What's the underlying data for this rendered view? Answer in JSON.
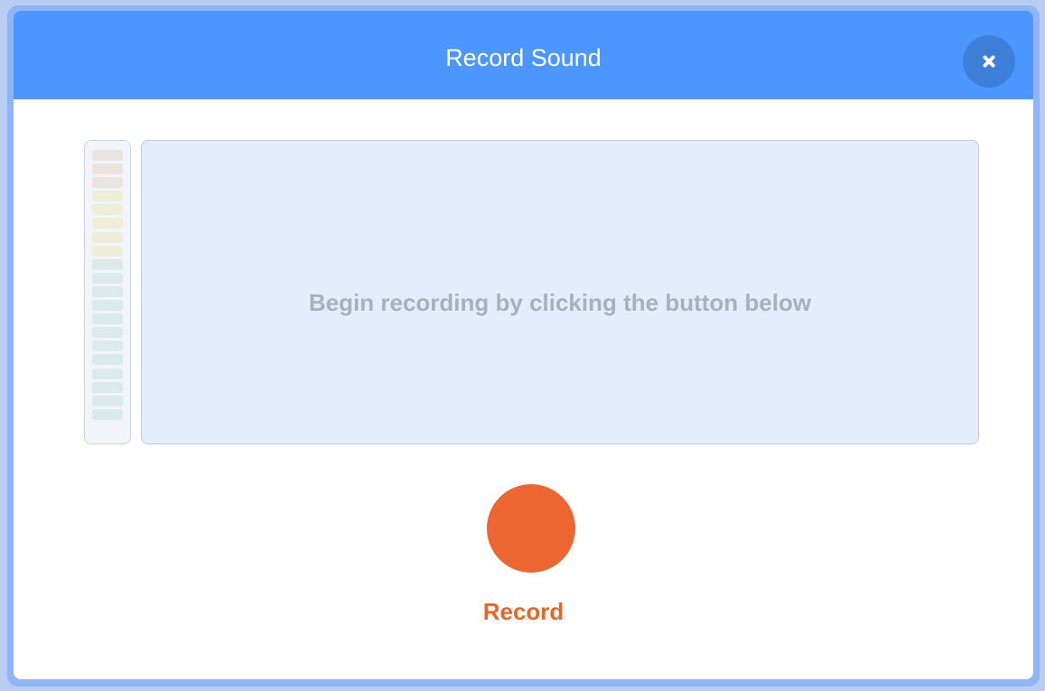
{
  "dialog": {
    "title": "Record Sound",
    "close_icon": "close-icon"
  },
  "level_meter": {
    "level": 0,
    "segments": [
      {
        "zone": "red",
        "color": "#ece4e1"
      },
      {
        "zone": "red",
        "color": "#ece4e1"
      },
      {
        "zone": "red",
        "color": "#ece4e1"
      },
      {
        "zone": "yellow",
        "color": "#eeeed9"
      },
      {
        "zone": "yellow",
        "color": "#eeeed9"
      },
      {
        "zone": "yellow",
        "color": "#eeeed9"
      },
      {
        "zone": "yellow",
        "color": "#eeeed9"
      },
      {
        "zone": "yellow",
        "color": "#eeeed9"
      },
      {
        "zone": "green",
        "color": "#dcebe9"
      },
      {
        "zone": "green",
        "color": "#dcebe9"
      },
      {
        "zone": "green",
        "color": "#dcebe9"
      },
      {
        "zone": "green",
        "color": "#dcebe9"
      },
      {
        "zone": "green",
        "color": "#dcebe9"
      },
      {
        "zone": "green",
        "color": "#dcebe9"
      },
      {
        "zone": "green",
        "color": "#dcebe9"
      },
      {
        "zone": "green",
        "color": "#dcebe9"
      },
      {
        "zone": "green",
        "color": "#dcebe9"
      },
      {
        "zone": "green",
        "color": "#dcebe9"
      },
      {
        "zone": "green",
        "color": "#dcebe9"
      },
      {
        "zone": "green",
        "color": "#dcebe9"
      }
    ]
  },
  "waveform": {
    "hint": "Begin recording by clicking the button below"
  },
  "record": {
    "label": "Record",
    "color": "#ed6530"
  },
  "colors": {
    "header": "#4c97ff",
    "close_button": "#3e7fd9",
    "record_text": "#ea6525"
  }
}
